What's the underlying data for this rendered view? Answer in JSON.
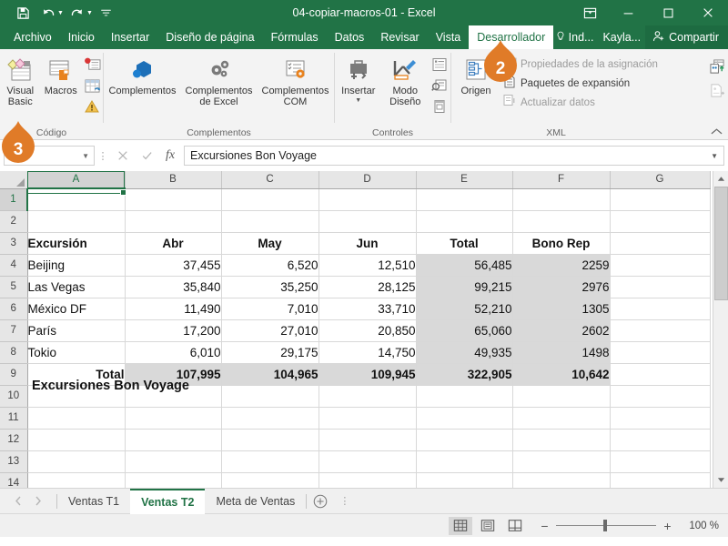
{
  "window": {
    "title": "04-copiar-macros-01  -  Excel",
    "quick_access": [
      "save-icon",
      "undo-icon",
      "redo-icon",
      "customize-qat-icon"
    ],
    "controls": [
      "ribbon-display-options-icon",
      "minimize-icon",
      "maximize-icon",
      "close-icon"
    ]
  },
  "ribbon_tabs": [
    {
      "label": "Archivo",
      "active": false
    },
    {
      "label": "Inicio",
      "active": false
    },
    {
      "label": "Insertar",
      "active": false
    },
    {
      "label": "Diseño de página",
      "active": false
    },
    {
      "label": "Fórmulas",
      "active": false
    },
    {
      "label": "Datos",
      "active": false
    },
    {
      "label": "Revisar",
      "active": false
    },
    {
      "label": "Vista",
      "active": false
    },
    {
      "label": "Desarrollador",
      "active": true
    }
  ],
  "tab_right": {
    "tellme": "Ind...",
    "account": "Kayla...",
    "share": "Compartir"
  },
  "ribbon": {
    "groups": [
      {
        "name": "Código",
        "label": "Código",
        "buttons": [
          {
            "label": "Visual Basic",
            "icon": "visual-basic-icon"
          },
          {
            "label": "Macros",
            "icon": "macros-icon"
          }
        ],
        "small_buttons": [
          {
            "icon": "grabar-macro-icon"
          },
          {
            "icon": "referencias-relativas-icon"
          },
          {
            "icon": "seguridad-macros-icon"
          }
        ]
      },
      {
        "name": "Complementos",
        "label": "Complementos",
        "buttons": [
          {
            "label": "Complementos",
            "icon": "complementos-icon"
          },
          {
            "label": "Complementos de Excel",
            "icon": "complementos-excel-icon"
          },
          {
            "label": "Complementos COM",
            "icon": "complementos-com-icon"
          }
        ]
      },
      {
        "name": "Controles",
        "label": "Controles",
        "buttons": [
          {
            "label": "Insertar",
            "icon": "insertar-control-icon"
          },
          {
            "label": "Modo Diseño",
            "icon": "modo-diseno-icon"
          }
        ],
        "small_buttons": [
          {
            "icon": "propiedades-icon"
          },
          {
            "icon": "ver-codigo-icon"
          },
          {
            "icon": "ejecutar-cuadro-dialogo-icon"
          }
        ]
      },
      {
        "name": "XML",
        "label": "XML",
        "buttons": [
          {
            "label": "Origen",
            "icon": "origen-xml-icon"
          }
        ],
        "rows": [
          {
            "label": "Propiedades de la asignación",
            "icon": "propiedades-asignacion-icon",
            "enabled": false
          },
          {
            "label": "Paquetes de expansión",
            "icon": "paquetes-expansion-icon",
            "enabled": true
          },
          {
            "label": "Actualizar datos",
            "icon": "actualizar-datos-icon",
            "enabled": false
          }
        ],
        "right_buttons": [
          {
            "icon": "importar-xml-icon"
          },
          {
            "icon": "exportar-xml-icon"
          }
        ]
      }
    ]
  },
  "formula_bar": {
    "name_box": "A1",
    "cancel": "cancel-icon",
    "accept": "accept-icon",
    "fx": "fx",
    "value": "Excursiones Bon Voyage"
  },
  "sheet": {
    "columns": [
      "A",
      "B",
      "C",
      "D",
      "E",
      "F",
      "G"
    ],
    "selected_column": "A",
    "selected_row": 1,
    "selected_cell": "A1",
    "rows": [
      {
        "n": "1",
        "cells": [
          {
            "v": "Excursiones Bon Voyage",
            "align": "l",
            "bold": true,
            "hidden": true
          },
          {
            "v": ""
          },
          {
            "v": ""
          },
          {
            "v": ""
          },
          {
            "v": ""
          },
          {
            "v": ""
          },
          {
            "v": ""
          }
        ]
      },
      {
        "n": "2",
        "cells": [
          {
            "v": ""
          },
          {
            "v": ""
          },
          {
            "v": ""
          },
          {
            "v": ""
          },
          {
            "v": ""
          },
          {
            "v": ""
          },
          {
            "v": ""
          }
        ]
      },
      {
        "n": "3",
        "cells": [
          {
            "v": "Excursión",
            "align": "l",
            "bold": true
          },
          {
            "v": "Abr",
            "align": "c",
            "bold": true
          },
          {
            "v": "May",
            "align": "c",
            "bold": true
          },
          {
            "v": "Jun",
            "align": "c",
            "bold": true
          },
          {
            "v": "Total",
            "align": "c",
            "bold": true
          },
          {
            "v": "Bono Rep",
            "align": "c",
            "bold": true
          },
          {
            "v": ""
          }
        ]
      },
      {
        "n": "4",
        "cells": [
          {
            "v": "Beijing",
            "align": "l"
          },
          {
            "v": "37,455",
            "align": "r"
          },
          {
            "v": "6,520",
            "align": "r"
          },
          {
            "v": "12,510",
            "align": "r"
          },
          {
            "v": "56,485",
            "align": "r",
            "shade": true
          },
          {
            "v": "2259",
            "align": "r",
            "shade": true
          },
          {
            "v": ""
          }
        ]
      },
      {
        "n": "5",
        "cells": [
          {
            "v": "Las Vegas",
            "align": "l"
          },
          {
            "v": "35,840",
            "align": "r"
          },
          {
            "v": "35,250",
            "align": "r"
          },
          {
            "v": "28,125",
            "align": "r"
          },
          {
            "v": "99,215",
            "align": "r",
            "shade": true
          },
          {
            "v": "2976",
            "align": "r",
            "shade": true
          },
          {
            "v": ""
          }
        ]
      },
      {
        "n": "6",
        "cells": [
          {
            "v": "México DF",
            "align": "l"
          },
          {
            "v": "11,490",
            "align": "r"
          },
          {
            "v": "7,010",
            "align": "r"
          },
          {
            "v": "33,710",
            "align": "r"
          },
          {
            "v": "52,210",
            "align": "r",
            "shade": true
          },
          {
            "v": "1305",
            "align": "r",
            "shade": true
          },
          {
            "v": ""
          }
        ]
      },
      {
        "n": "7",
        "cells": [
          {
            "v": "París",
            "align": "l"
          },
          {
            "v": "17,200",
            "align": "r"
          },
          {
            "v": "27,010",
            "align": "r"
          },
          {
            "v": "20,850",
            "align": "r"
          },
          {
            "v": "65,060",
            "align": "r",
            "shade": true
          },
          {
            "v": "2602",
            "align": "r",
            "shade": true
          },
          {
            "v": ""
          }
        ]
      },
      {
        "n": "8",
        "cells": [
          {
            "v": "Tokio",
            "align": "l"
          },
          {
            "v": "6,010",
            "align": "r"
          },
          {
            "v": "29,175",
            "align": "r"
          },
          {
            "v": "14,750",
            "align": "r"
          },
          {
            "v": "49,935",
            "align": "r",
            "shade": true
          },
          {
            "v": "1498",
            "align": "r",
            "shade": true
          },
          {
            "v": ""
          }
        ]
      },
      {
        "n": "9",
        "cells": [
          {
            "v": "Total",
            "align": "r",
            "bold": true
          },
          {
            "v": "107,995",
            "align": "r",
            "bold": true,
            "shade": true
          },
          {
            "v": "104,965",
            "align": "r",
            "bold": true,
            "shade": true
          },
          {
            "v": "109,945",
            "align": "r",
            "bold": true,
            "shade": true
          },
          {
            "v": "322,905",
            "align": "r",
            "bold": true,
            "shade": true
          },
          {
            "v": "10,642",
            "align": "r",
            "bold": true,
            "shade": true
          },
          {
            "v": ""
          }
        ]
      },
      {
        "n": "10",
        "cells": [
          {
            "v": ""
          },
          {
            "v": ""
          },
          {
            "v": ""
          },
          {
            "v": ""
          },
          {
            "v": ""
          },
          {
            "v": ""
          },
          {
            "v": ""
          }
        ]
      },
      {
        "n": "11",
        "cells": [
          {
            "v": ""
          },
          {
            "v": ""
          },
          {
            "v": ""
          },
          {
            "v": ""
          },
          {
            "v": ""
          },
          {
            "v": ""
          },
          {
            "v": ""
          }
        ]
      },
      {
        "n": "12",
        "cells": [
          {
            "v": ""
          },
          {
            "v": ""
          },
          {
            "v": ""
          },
          {
            "v": ""
          },
          {
            "v": ""
          },
          {
            "v": ""
          },
          {
            "v": ""
          }
        ]
      },
      {
        "n": "13",
        "cells": [
          {
            "v": ""
          },
          {
            "v": ""
          },
          {
            "v": ""
          },
          {
            "v": ""
          },
          {
            "v": ""
          },
          {
            "v": ""
          },
          {
            "v": ""
          }
        ]
      },
      {
        "n": "14",
        "cells": [
          {
            "v": ""
          },
          {
            "v": ""
          },
          {
            "v": ""
          },
          {
            "v": ""
          },
          {
            "v": ""
          },
          {
            "v": ""
          },
          {
            "v": ""
          }
        ]
      }
    ],
    "cell_a1_display": "Excursiones Bon Voyage"
  },
  "sheet_tabs": [
    {
      "label": "Ventas T1",
      "active": false
    },
    {
      "label": "Ventas T2",
      "active": true
    },
    {
      "label": "Meta de Ventas",
      "active": false
    }
  ],
  "sheet_tabs_add": "add-sheet-icon",
  "status_bar": {
    "views": [
      {
        "icon": "normal-view-icon",
        "active": true
      },
      {
        "icon": "page-layout-view-icon",
        "active": false
      },
      {
        "icon": "page-break-view-icon",
        "active": false
      }
    ],
    "zoom_out": "−",
    "zoom_in": "+",
    "zoom_label": "100 %"
  },
  "callouts": [
    {
      "number": "2",
      "name": "callout-badge-2"
    },
    {
      "number": "3",
      "name": "callout-badge-3"
    }
  ],
  "colors": {
    "brand_green": "#217346",
    "callout_orange": "#E07B28",
    "ribbon_bg": "#F3F3F3",
    "shade_gray": "#D9D9D9"
  }
}
